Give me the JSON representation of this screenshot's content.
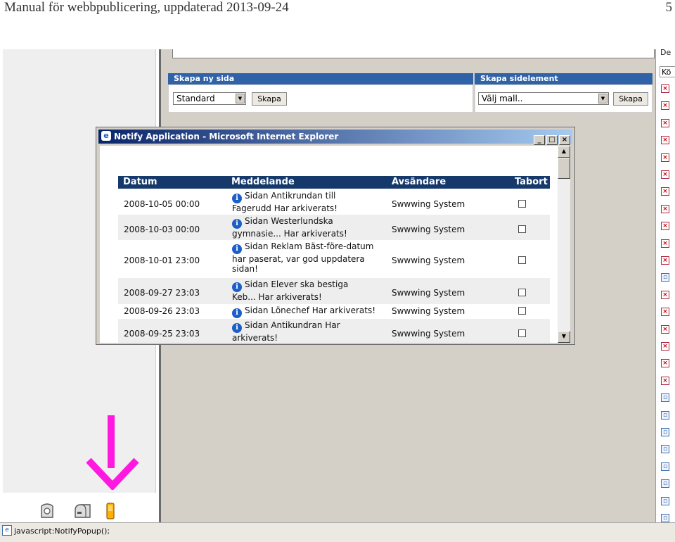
{
  "document": {
    "header": "Manual för webbpublicering, uppdaterad 2013-09-24",
    "page_number": "5"
  },
  "cms": {
    "right_column_labels": [
      "De",
      "Kö"
    ],
    "create_page": {
      "title": "Skapa ny sida",
      "select_value": "Standard",
      "button": "Skapa"
    },
    "create_element": {
      "title": "Skapa sidelement",
      "select_value": "Välj mall..",
      "button": "Skapa"
    }
  },
  "status_bar": {
    "text": "javascript:NotifyPopup();"
  },
  "popup": {
    "title": "Notify Application - Microsoft Internet Explorer",
    "window_buttons": [
      "_",
      "□",
      "×"
    ],
    "columns": [
      "Datum",
      "Meddelande",
      "Avsändare",
      "Tabort"
    ],
    "rows": [
      {
        "date": "2008-10-05 00:00",
        "message_lines": [
          "Sidan Antikrundan till",
          "Fagerudd Har arkiverats!"
        ],
        "sender": "Swwwing System",
        "checked": false
      },
      {
        "date": "2008-10-03 00:00",
        "message_lines": [
          "Sidan Westerlundska",
          "gymnasie... Har arkiverats!"
        ],
        "sender": "Swwwing System",
        "checked": false
      },
      {
        "date": "2008-10-01 23:00",
        "message_lines": [
          "Sidan Reklam Bäst-före-datum",
          "har paserat, var god uppdatera",
          "sidan!"
        ],
        "sender": "Swwwing System",
        "checked": false
      },
      {
        "date": "2008-09-27 23:03",
        "message_lines": [
          "Sidan Elever ska bestiga",
          "Keb... Har arkiverats!"
        ],
        "sender": "Swwwing System",
        "checked": false
      },
      {
        "date": "2008-09-26 23:03",
        "message_lines": [
          "Sidan Lönechef Har arkiverats!"
        ],
        "sender": "Swwwing System",
        "checked": false
      },
      {
        "date": "2008-09-25 23:03",
        "message_lines": [
          "Sidan Antikundran Har",
          "arkiverats!"
        ],
        "sender": "Swwwing System",
        "checked": false
      }
    ]
  },
  "icons": {
    "annotation_arrow_color": "#ff18e0",
    "tray": [
      "security-icon",
      "mailbox-icon",
      "notify-icon"
    ]
  }
}
